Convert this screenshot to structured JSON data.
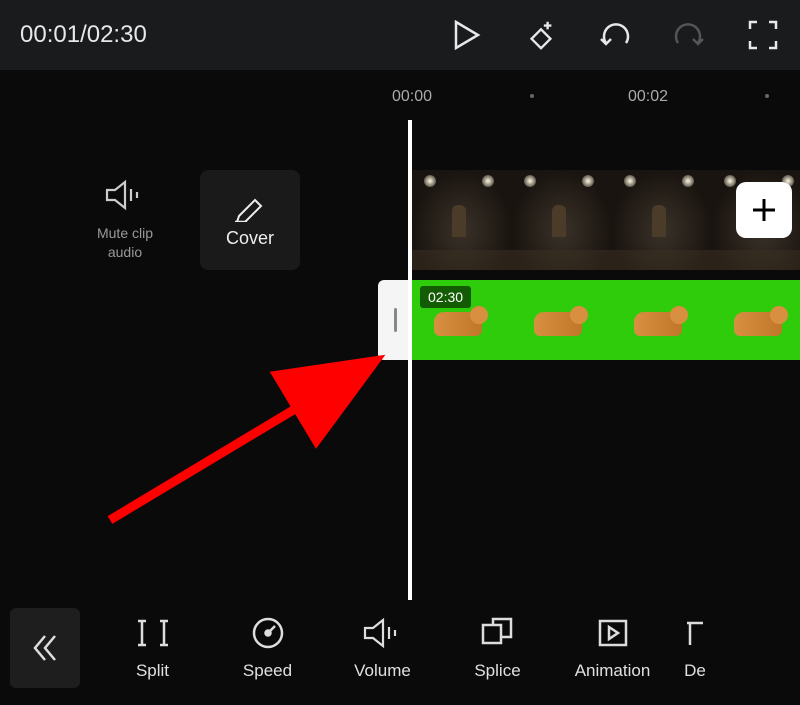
{
  "header": {
    "current_time": "00:01",
    "total_time": "02:30"
  },
  "ruler": {
    "marks": [
      "00:00",
      "00:02"
    ]
  },
  "left_panel": {
    "mute_label": "Mute clip audio",
    "cover_label": "Cover"
  },
  "overlay": {
    "duration_badge": "02:30"
  },
  "toolbar": {
    "items": [
      {
        "label": "Split"
      },
      {
        "label": "Speed"
      },
      {
        "label": "Volume"
      },
      {
        "label": "Splice"
      },
      {
        "label": "Animation"
      },
      {
        "label": "De"
      }
    ]
  }
}
